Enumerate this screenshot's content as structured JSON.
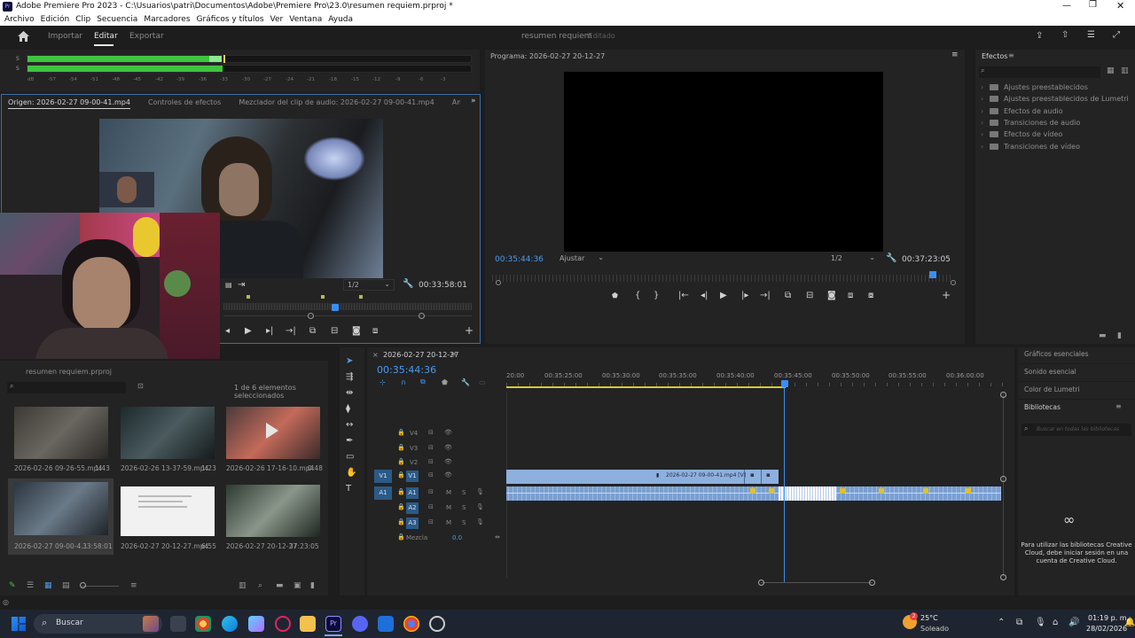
{
  "window": {
    "title": "Adobe Premiere Pro 2023 - C:\\Usuarios\\patri\\Documentos\\Adobe\\Premiere Pro\\23.0\\resumen requiem.prproj *"
  },
  "menu": [
    "Archivo",
    "Edición",
    "Clip",
    "Secuencia",
    "Marcadores",
    "Gráficos y títulos",
    "Ver",
    "Ventana",
    "Ayuda"
  ],
  "header": {
    "tabs": [
      "Importar",
      "Editar",
      "Exportar"
    ],
    "active_tab": "Editar",
    "project": "resumen requiem",
    "status": "- Editado"
  },
  "audio_meter": {
    "scale": [
      "dB",
      "-57",
      "-54",
      "-51",
      "-48",
      "-45",
      "-42",
      "-39",
      "-36",
      "-33",
      "-30",
      "-27",
      "-24",
      "-21",
      "-18",
      "-15",
      "-12",
      "-9",
      "-6",
      "-3"
    ],
    "channels": [
      "S",
      "S"
    ]
  },
  "source": {
    "tabs": [
      "Origen: 2026-02-27 09-00-41.mp4",
      "Controles de efectos",
      "Mezclador del clip de audio: 2026-02-27 09-00-41.mp4",
      "Ámbitos de Lumetri"
    ],
    "resolution": "1/2",
    "duration": "00:33:58:01"
  },
  "program": {
    "title": "Programa: 2026-02-27 20-12-27",
    "timecode": "00:35:44:36",
    "fit": "Ajustar",
    "resolution": "1/2",
    "duration": "00:37:23:05"
  },
  "effects": {
    "title": "Efectos",
    "items": [
      "Ajustes preestablecidos",
      "Ajustes preestablecidos de Lumetri",
      "Efectos de audio",
      "Transiciones de audio",
      "Efectos de vídeo",
      "Transiciones de vídeo"
    ]
  },
  "project": {
    "tab": "resumen requiem.prproj",
    "selection": "1 de 6 elementos seleccionados",
    "items": [
      {
        "name": "2026-02-26 09-26-55.mp4",
        "duration": "1:43"
      },
      {
        "name": "2026-02-26 13-37-59.mp4",
        "duration": "1:23"
      },
      {
        "name": "2026-02-26 17-16-10.mp4",
        "duration": "0:48"
      },
      {
        "name": "2026-02-27 09-00-4...",
        "duration": "33:58:01"
      },
      {
        "name": "2026-02-27 20-12-27.mp4",
        "duration": "6:55"
      },
      {
        "name": "2026-02-27 20-12-27",
        "duration": "37:23:05"
      }
    ]
  },
  "timeline": {
    "sequence": "2026-02-27 20-12-27",
    "timecode": "00:35:44:36",
    "ruler": [
      "20:00",
      "00:35:25:00",
      "00:35:30:00",
      "00:35:35:00",
      "00:35:40:00",
      "00:35:45:00",
      "00:35:50:00",
      "00:35:55:00",
      "00:36:00:00"
    ],
    "video_tracks": [
      "V4",
      "V3",
      "V2",
      "V1"
    ],
    "audio_tracks": [
      "A1",
      "A2",
      "A3"
    ],
    "source_patch_v": "V1",
    "source_patch_a": "A1",
    "mix_label": "Mezcla",
    "mix_value": "0.0",
    "clip_label": "2026-02-27 09-00-41.mp4 [V]",
    "ms": [
      "M",
      "S"
    ]
  },
  "right_panel": {
    "items": [
      "Gráficos esenciales",
      "Sonido esencial",
      "Color de Lumetri",
      "Bibliotecas"
    ],
    "search_placeholder": "Buscar en todas las bibliotecas",
    "message": "Para utilizar las bibliotecas Creative Cloud, debe iniciar sesión en una cuenta de Creative Cloud."
  },
  "taskbar": {
    "search": "Buscar",
    "weather_temp": "25°C",
    "weather_desc": "Soleado",
    "weather_badge": "2",
    "time": "01:19 p. m.",
    "date": "28/02/2026"
  },
  "colors": {
    "accent": "#4a9bf0",
    "clip_video": "#8db0de",
    "clip_audio": "#7a9fd1",
    "meter": "#3ec43e",
    "playhead": "#3a8ef0"
  }
}
